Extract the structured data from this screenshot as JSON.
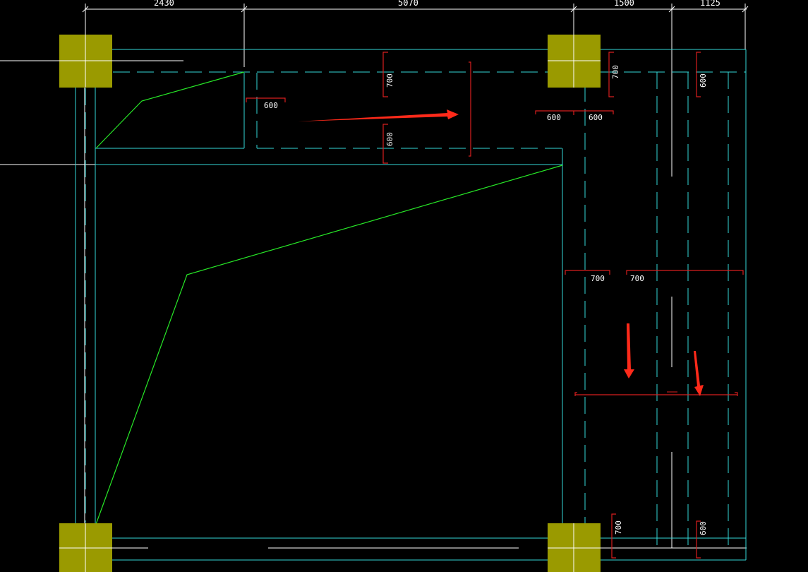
{
  "drawing": {
    "top_dimensions": [
      "2430",
      "5070",
      "1500",
      "1125"
    ],
    "rebar_labels": {
      "upper_700": "700",
      "upper_600_vertical": "600",
      "upper_600_horizontal": "600",
      "right_top_700": "700",
      "right_top_600_vertical": "600",
      "center_600_left": "600",
      "center_600_right": "600",
      "mid_700_left": "700",
      "mid_700_right": "700",
      "bottom_700": "700",
      "bottom_600": "600"
    },
    "colors": {
      "background": "#000000",
      "column_fill": "#9a9a00",
      "beam_line": "#34d8d8",
      "slab_outline": "#27e827",
      "rebar": "#d81f1f",
      "arrow": "#ff2a1a",
      "dimension_line": "#ffffff"
    }
  }
}
